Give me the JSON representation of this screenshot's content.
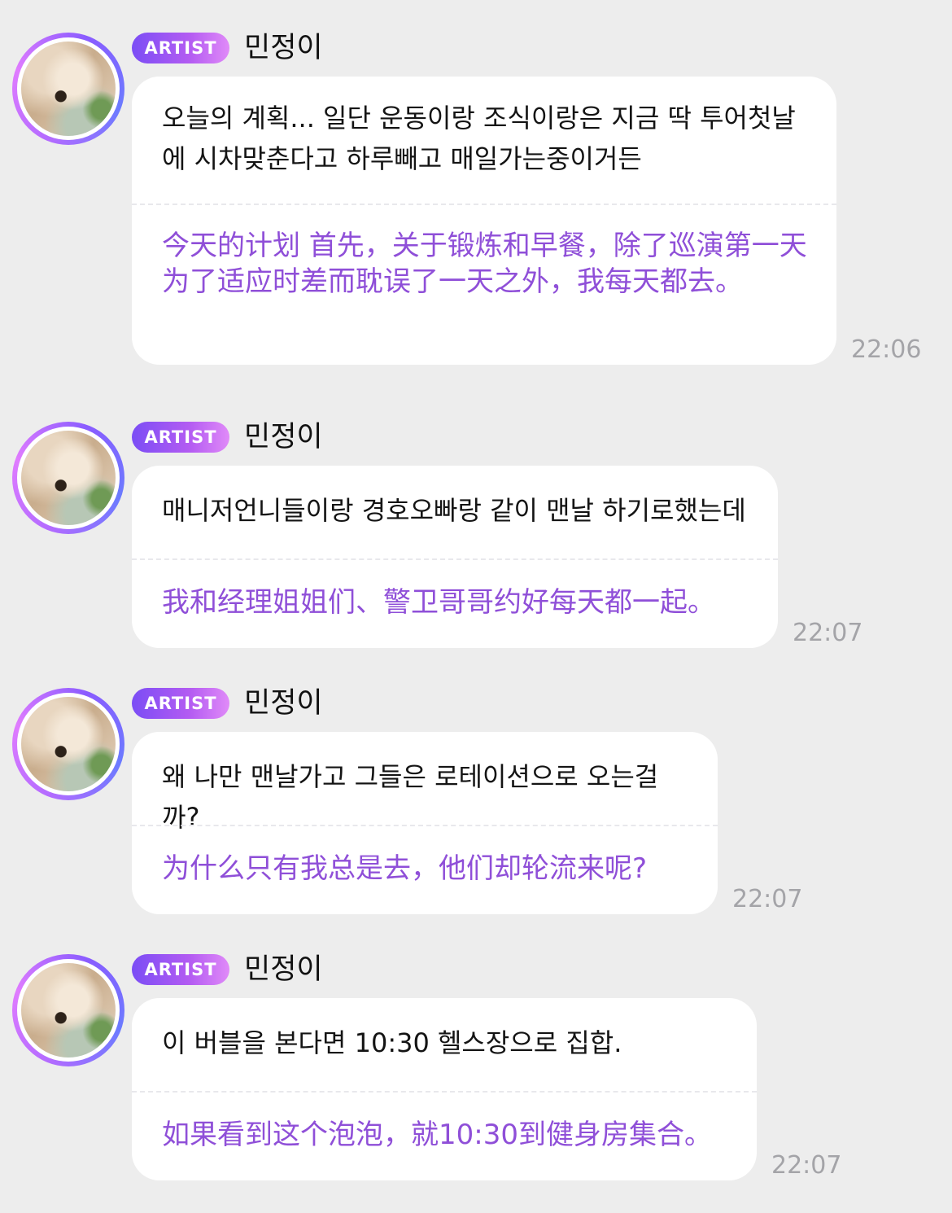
{
  "messages": [
    {
      "badge": "ARTIST",
      "name": "민정이",
      "korean": "오늘의 계획... 일단 운동이랑 조식이랑은 지금 딱 투어첫날에 시차맞춘다고 하루빼고 매일가는중이거든",
      "chinese": "今天的计划 首先，关于锻炼和早餐，除了巡演第一天为了适应时差而耽误了一天之外，我每天都去。",
      "time": "22:06"
    },
    {
      "badge": "ARTIST",
      "name": "민정이",
      "korean": "매니저언니들이랑 경호오빠랑 같이 맨날 하기로했는데",
      "chinese": "我和经理姐姐们、警卫哥哥约好每天都一起。",
      "time": "22:07"
    },
    {
      "badge": "ARTIST",
      "name": "민정이",
      "korean": "왜 나만 맨날가고 그들은 로테이션으로 오는걸까?",
      "chinese": "为什么只有我总是去，他们却轮流来呢?",
      "time": "22:07"
    },
    {
      "badge": "ARTIST",
      "name": "민정이",
      "korean": "이 버블을 본다면 10:30 헬스장으로 집합.",
      "chinese": "如果看到这个泡泡，就10:30到健身房集合。",
      "time": "22:07"
    }
  ]
}
